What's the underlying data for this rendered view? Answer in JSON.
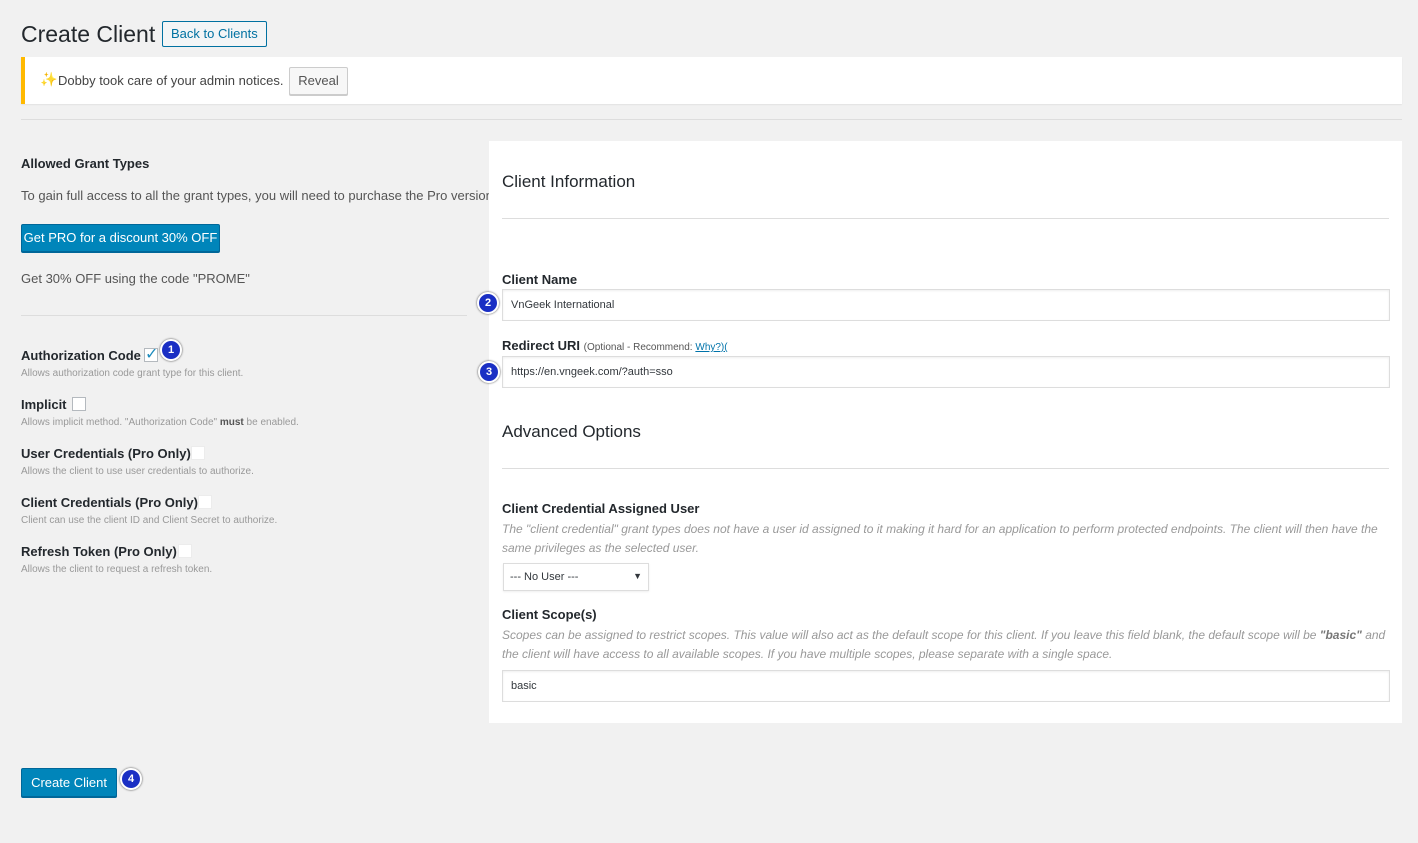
{
  "header": {
    "title": "Create Client",
    "back_button": "Back to Clients"
  },
  "notice": {
    "icon": "sparkle-icon",
    "text": "Dobby took care of your admin notices.",
    "reveal_button": "Reveal"
  },
  "left": {
    "heading": "Allowed Grant Types",
    "intro": "To gain full access to all the grant types, you will need to purchase the Pro version.",
    "pro_button": "Get PRO for a discount 30% OFF",
    "coupon": "Get 30% OFF using the code \"PROME\"",
    "grants": [
      {
        "label": "Authorization Code",
        "desc": "Allows authorization code grant type for this client.",
        "checked": true,
        "disabled": false
      },
      {
        "label": "Implicit",
        "desc_pre": "Allows implicit method. \"Authorization Code\"",
        "desc_bold": "must",
        "desc_post": "be enabled.",
        "checked": false,
        "disabled": false
      },
      {
        "label": "User Credentials (Pro Only)",
        "desc": "Allows the client to use user credentials to authorize.",
        "checked": false,
        "disabled": true
      },
      {
        "label": "Client Credentials (Pro Only)",
        "desc": "Client can use the client ID and Client Secret to authorize.",
        "checked": false,
        "disabled": true
      },
      {
        "label": "Refresh Token (Pro Only)",
        "desc": "Allows the client to request a refresh token.",
        "checked": false,
        "disabled": true
      }
    ]
  },
  "panel": {
    "info_heading": "Client Information",
    "client_name_label": "Client Name",
    "client_name_value": "VnGeek International",
    "redirect_label": "Redirect URI",
    "redirect_optional": "(Optional - Recommend:",
    "redirect_link": "Why?)(",
    "redirect_value": "https://en.vngeek.com/?auth=sso",
    "advanced_heading": "Advanced Options",
    "assigned_user_label": "Client Credential Assigned User",
    "assigned_user_desc": "The \"client credential\" grant types does not have a user id assigned to it making it hard for an application to perform protected endpoints. The client will then have the same privileges as the selected user.",
    "assigned_user_selected": "--- No User ---",
    "scopes_label": "Client Scope(s)",
    "scopes_desc_pre": "Scopes can be assigned to restrict scopes. This value will also act as the default scope for this client. If you leave this field blank, the default scope will be",
    "scopes_desc_bold": "\"basic\"",
    "scopes_desc_post": "and the client will have access to all available scopes. If you have multiple scopes, please separate with a single space.",
    "scopes_value": "basic"
  },
  "submit_button": "Create Client",
  "annotations": [
    "1",
    "2",
    "3",
    "4"
  ],
  "colors": {
    "primary": "#0085ba",
    "notice_border": "#ffb900",
    "badge": "#1a2fc4"
  }
}
